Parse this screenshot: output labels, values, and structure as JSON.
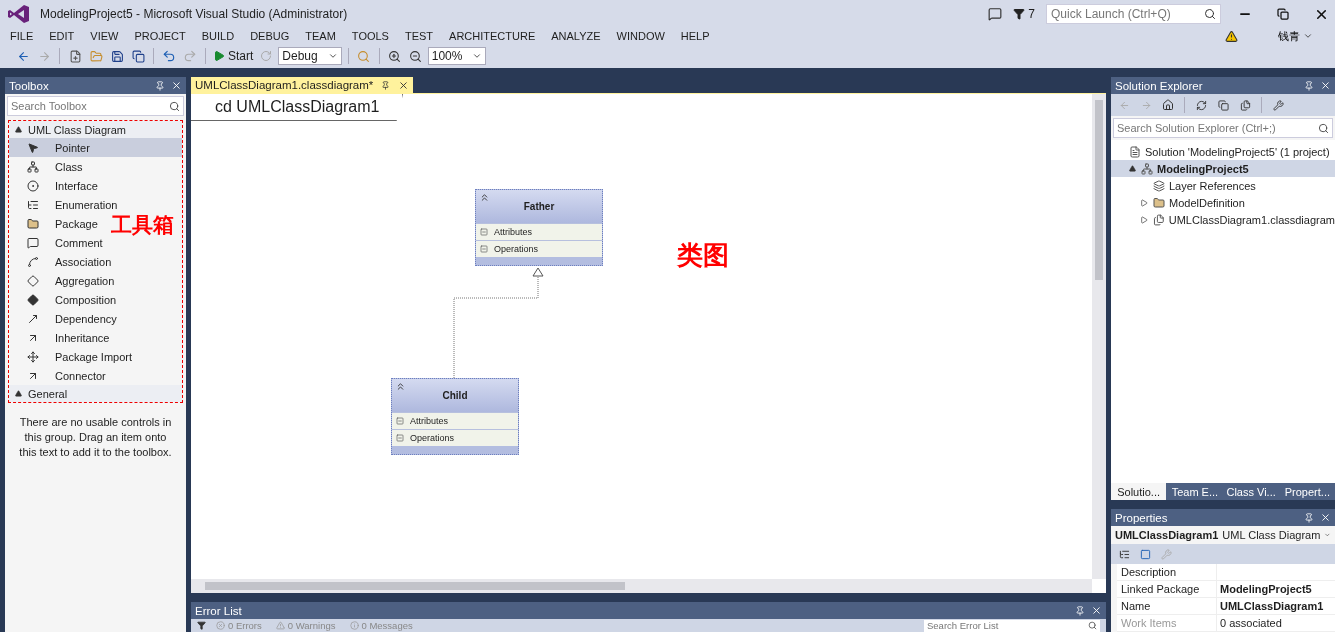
{
  "window": {
    "title": "ModelingProject5 - Microsoft Visual Studio (Administrator)",
    "notifications": "7",
    "quick_launch": {
      "placeholder": "Quick Launch (Ctrl+Q)"
    },
    "user": "钱青"
  },
  "menu": [
    "FILE",
    "EDIT",
    "VIEW",
    "PROJECT",
    "BUILD",
    "DEBUG",
    "TEAM",
    "TOOLS",
    "TEST",
    "ARCHITECTURE",
    "ANALYZE",
    "WINDOW",
    "HELP"
  ],
  "toolbar": {
    "start": "Start",
    "configuration": "Debug",
    "zoom": "100%"
  },
  "toolbox": {
    "title": "Toolbox",
    "search": {
      "placeholder": "Search Toolbox"
    },
    "groups": [
      {
        "label": "UML Class Diagram",
        "expanded": true,
        "items": [
          {
            "label": "Pointer",
            "selected": true
          },
          {
            "label": "Class",
            "selected": false
          },
          {
            "label": "Interface",
            "selected": false
          },
          {
            "label": "Enumeration",
            "selected": false
          },
          {
            "label": "Package",
            "selected": false
          },
          {
            "label": "Comment",
            "selected": false
          },
          {
            "label": "Association",
            "selected": false
          },
          {
            "label": "Aggregation",
            "selected": false
          },
          {
            "label": "Composition",
            "selected": false
          },
          {
            "label": "Dependency",
            "selected": false
          },
          {
            "label": "Inheritance",
            "selected": false
          },
          {
            "label": "Package Import",
            "selected": false
          },
          {
            "label": "Connector",
            "selected": false
          }
        ]
      },
      {
        "label": "General",
        "expanded": true
      }
    ],
    "empty_message": "There are no usable controls in this group. Drag an item onto this text to add it to the toolbox.",
    "annotation": "工具箱"
  },
  "document": {
    "tab": {
      "title": "UMLClassDiagram1.classdiagram*",
      "selected": true
    },
    "frame_label": "cd UMLClassDiagram1",
    "classes": [
      {
        "name": "Father",
        "compartments": [
          "Attributes",
          "Operations"
        ]
      },
      {
        "name": "Child",
        "compartments": [
          "Attributes",
          "Operations"
        ]
      }
    ],
    "annotation": "类图"
  },
  "error_list": {
    "title": "Error List",
    "filters": [
      "0 Errors",
      "0 Warnings",
      "0 Messages"
    ],
    "search": {
      "placeholder": "Search Error List"
    }
  },
  "solution_explorer": {
    "title": "Solution Explorer",
    "search": {
      "placeholder": "Search Solution Explorer (Ctrl+;)"
    },
    "tree": [
      {
        "label": "Solution 'ModelingProject5' (1 project)",
        "selected": false,
        "children": [
          {
            "label": "ModelingProject5",
            "selected": true,
            "expanded": true,
            "children": [
              {
                "label": "Layer References",
                "selected": false
              },
              {
                "label": "ModelDefinition",
                "selected": false,
                "expanded": false
              },
              {
                "label": "UMLClassDiagram1.classdiagram",
                "selected": false,
                "expanded": false
              }
            ]
          }
        ]
      }
    ]
  },
  "panel_tabs": [
    {
      "label": "Solutio...",
      "selected": true
    },
    {
      "label": "Team E...",
      "selected": false
    },
    {
      "label": "Class Vi...",
      "selected": false
    },
    {
      "label": "Propert...",
      "selected": false
    }
  ],
  "properties": {
    "title": "Properties",
    "object_name": "UMLClassDiagram1",
    "object_type": "UML Class Diagram",
    "rows": [
      {
        "name": "Description"
      },
      {
        "name": "Linked Package",
        "value": "ModelingProject5"
      },
      {
        "name": "Name",
        "value": "UMLClassDiagram1"
      },
      {
        "name": "Work Items",
        "value": "0 associated"
      }
    ]
  }
}
